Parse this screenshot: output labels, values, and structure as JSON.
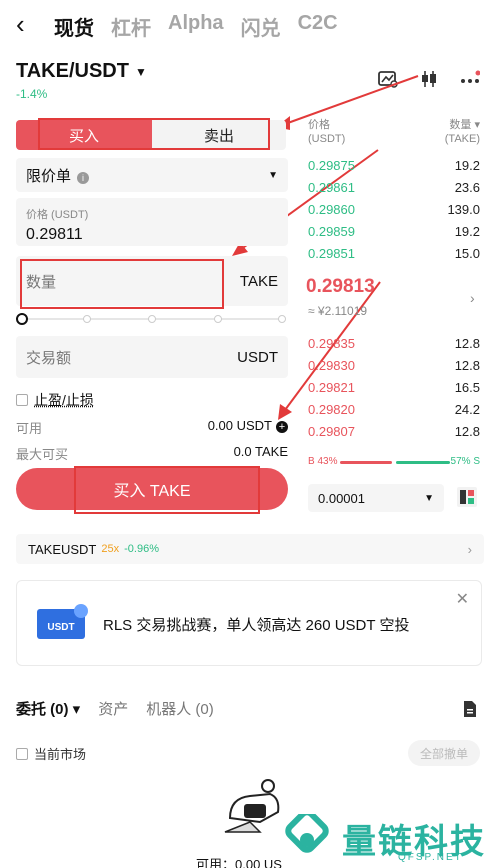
{
  "nav": {
    "back_icon": "chevron-left-icon",
    "tabs": [
      "现货",
      "杠杆",
      "Alpha",
      "闪兑",
      "C2C"
    ]
  },
  "pair": {
    "symbol": "TAKE/USDT",
    "change": "-1.4%"
  },
  "trade": {
    "buy_label": "买入",
    "sell_label": "卖出",
    "order_type": "限价单",
    "price_label": "价格 (USDT)",
    "price_value": "0.29811",
    "qty_placeholder": "数量",
    "qty_unit": "TAKE",
    "amount_placeholder": "交易额",
    "amount_unit": "USDT",
    "tpsl_label": "止盈/止损",
    "available_label": "可用",
    "available_value": "0.00 USDT",
    "max_label": "最大可买",
    "max_value": "0.0 TAKE",
    "buy_button": "买入 TAKE"
  },
  "orderbook": {
    "price_header": "价格",
    "price_unit": "(USDT)",
    "qty_header": "数量",
    "qty_unit": "(TAKE)",
    "asks": [
      {
        "price": "0.29875",
        "qty": "19.2"
      },
      {
        "price": "0.29861",
        "qty": "23.6"
      },
      {
        "price": "0.29860",
        "qty": "139.0"
      },
      {
        "price": "0.29859",
        "qty": "19.2"
      },
      {
        "price": "0.29851",
        "qty": "15.0"
      }
    ],
    "mid_price": "0.29813",
    "mid_cny": "≈ ¥2.11019",
    "bids": [
      {
        "price": "0.29835",
        "qty": "12.8"
      },
      {
        "price": "0.29830",
        "qty": "12.8"
      },
      {
        "price": "0.29821",
        "qty": "16.5"
      },
      {
        "price": "0.29820",
        "qty": "24.2"
      },
      {
        "price": "0.29807",
        "qty": "12.8"
      }
    ],
    "buy_ratio": "B 43%",
    "sell_ratio": "57% S",
    "precision": "0.00001"
  },
  "ticker": {
    "symbol": "TAKEUSDT",
    "leverage": "25x",
    "change": "-0.96%"
  },
  "banner": {
    "badge": "USDT",
    "text": "RLS 交易挑战赛，单人领高达 260 USDT 空投"
  },
  "bottom": {
    "tabs": [
      "委托 (0)",
      "资产",
      "机器人 (0)"
    ],
    "current_market": "当前市场",
    "cancel_all": "全部撤单",
    "available": "可用：0.00 US"
  },
  "watermark": {
    "text": "量链科技",
    "sub": "QFSP.NET"
  },
  "colors": {
    "accent_red": "#e8545c",
    "green": "#2ebd85",
    "annotation_red": "#e23a3a"
  }
}
